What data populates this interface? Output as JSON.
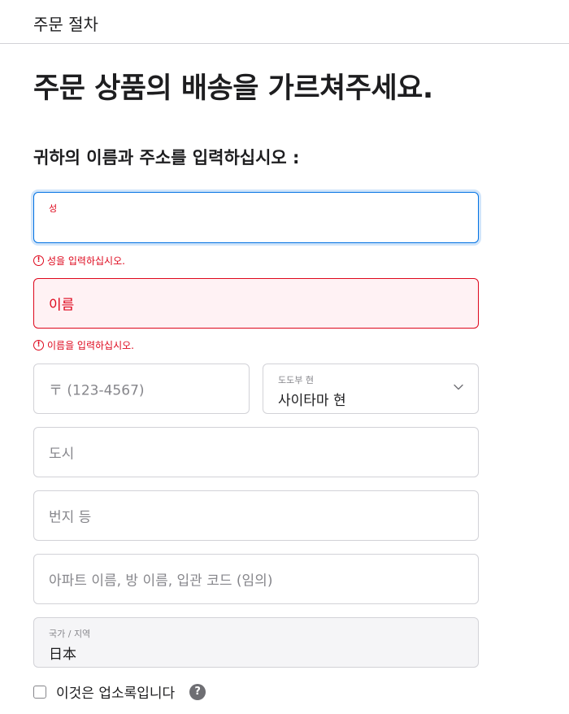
{
  "header": {
    "title": "주문 절차"
  },
  "page": {
    "heading": "주문 상품의 배송을 가르쳐주세요.",
    "section_heading": "귀하의 이름과 주소를 입력하십시오 :"
  },
  "form": {
    "last_name": {
      "label": "성",
      "value": "",
      "error": "성을 입력하십시오."
    },
    "first_name": {
      "placeholder": "이름",
      "error": "이름을 입력하십시오."
    },
    "postal_code": {
      "placeholder": "〒 (123-4567)"
    },
    "prefecture": {
      "label": "도도부 현",
      "selected": "사이타마 현"
    },
    "city": {
      "placeholder": "도시"
    },
    "street": {
      "placeholder": "번지 등"
    },
    "apartment": {
      "placeholder": "아파트 이름, 방 이름, 입관 코드 (임의)"
    },
    "country": {
      "label": "국가 / 지역",
      "value": "日本"
    },
    "business_checkbox": {
      "label": "이것은 업소록입니다",
      "checked": false
    }
  },
  "icons": {
    "error": "exclamation-circle-icon",
    "chevron": "chevron-down-icon",
    "help": "question-mark-icon"
  },
  "colors": {
    "error": "#de071c",
    "focus": "#0071e3",
    "text": "#1d1d1f",
    "placeholder": "#86868b"
  }
}
